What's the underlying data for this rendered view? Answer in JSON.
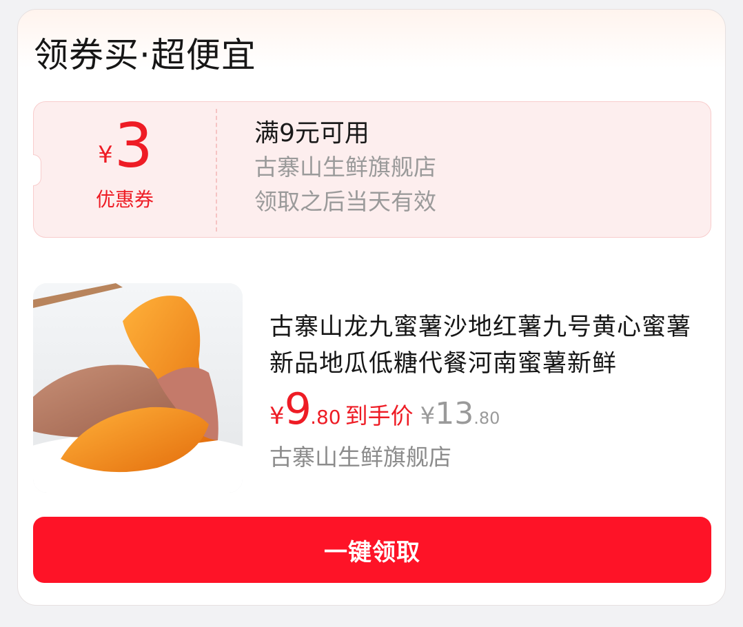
{
  "section": {
    "title": "领券买·超便宜"
  },
  "coupon": {
    "currency": "¥",
    "amount": "3",
    "kind_label": "优惠券",
    "condition": "满9元可用",
    "shop": "古寨山生鲜旗舰店",
    "validity": "领取之后当天有效"
  },
  "product": {
    "image_icon": "sweet-potato-photo",
    "name": "古寨山龙九蜜薯沙地红薯九号黄心蜜薯新品地瓜低糖代餐河南蜜薯新鲜",
    "price": {
      "currency": "¥",
      "integer": "9",
      "decimal": ".80",
      "label": "到手价"
    },
    "original_price": {
      "currency": "¥",
      "integer": "13",
      "decimal": ".80"
    },
    "shop": "古寨山生鲜旗舰店"
  },
  "action": {
    "claim_label": "一键领取"
  },
  "colors": {
    "accent": "#fe1327",
    "coupon_bg": "#fdeeee",
    "muted_text": "#9a9a9a"
  }
}
